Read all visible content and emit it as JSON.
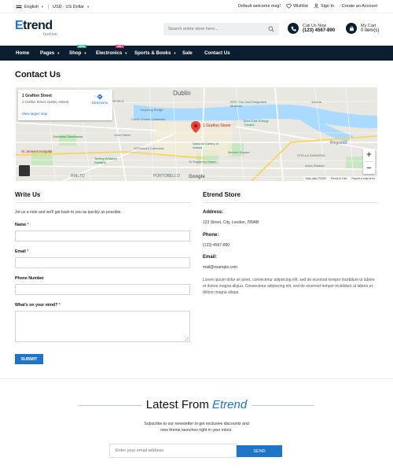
{
  "topbar": {
    "language": "English",
    "currency": "USD - US Dollar",
    "welcome": "Default welcome msg!",
    "wishlist": "Wishlist",
    "signin": "Sign In",
    "create_account": "Create an Account"
  },
  "header": {
    "logo_main_e": "E",
    "logo_main_rest": "trend",
    "logo_sub": "fashion",
    "search_placeholder": "Search entire store here...",
    "call_label": "Call Us Now",
    "call_number": "(123) 4567-890",
    "cart_label": "My Cart",
    "cart_items": "0 item(s)"
  },
  "nav": {
    "items": [
      {
        "label": "Home"
      },
      {
        "label": "Pages"
      },
      {
        "label": "Shop",
        "badge": "NEW"
      },
      {
        "label": "Electronics",
        "badge": "HOT"
      },
      {
        "label": "Sports & Books"
      },
      {
        "label": "Sale"
      },
      {
        "label": "Contact Us"
      }
    ]
  },
  "page_title": "Contact Us",
  "map": {
    "place_name": "1 Grafton Street",
    "place_address": "1 Grafton Street, Dublin, Ireland",
    "directions": "Directions",
    "larger_map": "View larger map",
    "pin_label": "1 Grafton Street",
    "city": "Dublin",
    "footer": [
      "Map data ©2020",
      "Terms of Use",
      "Report a map error"
    ],
    "google": "Google",
    "labels": [
      "RTHFIELD",
      "Ha'penny Bridge",
      "EPIC The Irish Emigration Museum",
      "3Arena",
      "Christ Church Cathedral",
      "Bord Gáis Energy Theatre",
      "National Gallery of Ireland",
      "Merrion Square",
      "Guinness Storehouse",
      "St James's Hospital",
      "Teeling Whiskey Distillery",
      "St Patrick's Cathedral",
      "St Stephen's Green",
      "Ringsend",
      "STELLA GARDENS",
      "Aviva Stadium",
      "PORTOBELLO",
      "RIALTO",
      "Vicar Street"
    ]
  },
  "form": {
    "heading": "Write Us",
    "intro": "Jot us a note and we'll get back to you as quickly as possible.",
    "name_label": "Name",
    "email_label": "Email",
    "phone_label": "Phone Number",
    "mind_label": "What's on your mind?",
    "required_mark": "*",
    "submit": "SUBMIT"
  },
  "store": {
    "heading": "Etrend Store",
    "address_label": "Address:",
    "address": "123 Street, City, London, 789AB",
    "phone_label": "Phone:",
    "phone": "(123) 4567-890",
    "email_label": "Email:",
    "email": "mail@example.com",
    "description": "Lorem ipsum dolor sit amet, consectetur adipiscing elit, sed do eiusmod tempor incididunt ut labore et dolore magna aliqua. Consectetur adipiscing elit, sed do eiusmod tempor incididunt ut labore et dolore magna aliqua."
  },
  "newsletter": {
    "title_plain": "Latest From",
    "title_brand": "Etrend",
    "subtitle_line1": "Subscribe to our newsletter to get exclusive discounts and",
    "subtitle_line2": "new theme launches right in your inbox.",
    "email_placeholder": "Enter your email address",
    "send": "SEND"
  },
  "colors": {
    "accent": "#1d74c9",
    "nav_bg": "#0b1e2f",
    "badge_new": "#19b58c",
    "badge_hot": "#e3346d",
    "required": "#e3242b"
  }
}
